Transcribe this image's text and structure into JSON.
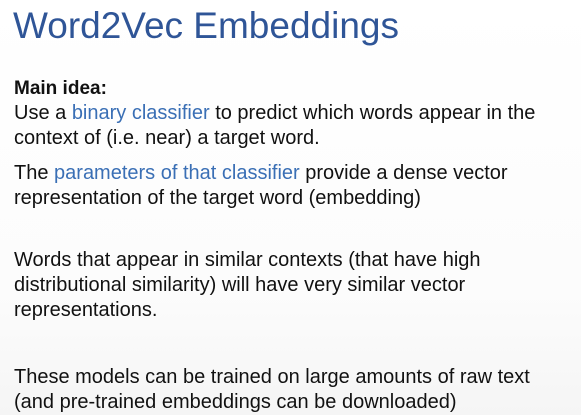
{
  "slide": {
    "title": "Word2Vec Embeddings",
    "heading": "Main idea:",
    "p1": {
      "pre": "Use a ",
      "highlight": "binary classifier",
      "post": " to predict which words appear in the context of (i.e. near) a target word."
    },
    "p2": {
      "pre": "The ",
      "highlight": "parameters of that classifier",
      "post": " provide a dense vector representation of the target word (embedding)"
    },
    "p3": "Words that appear in similar contexts (that have high distributional similarity) will have very similar vector representations.",
    "p4": "These models can be trained on large amounts of raw text (and pre-trained embeddings can be downloaded)"
  },
  "colors": {
    "title": "#2f5597",
    "highlight": "#3a6fb5",
    "text": "#111111"
  }
}
